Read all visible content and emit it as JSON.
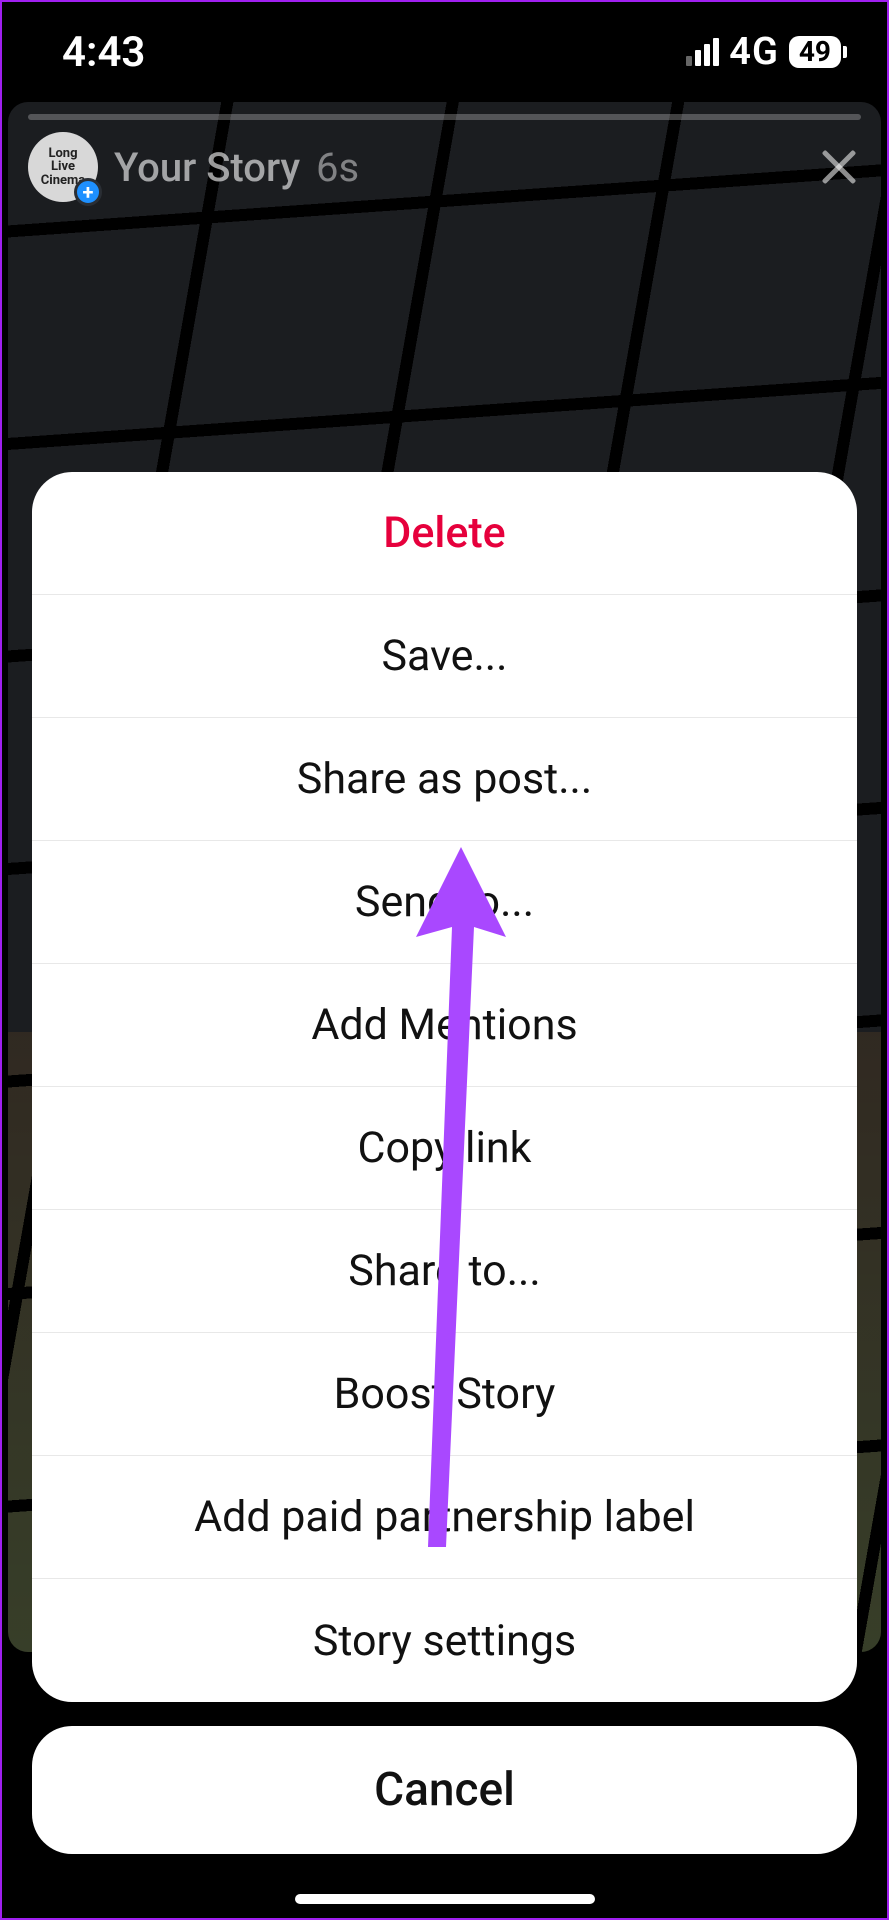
{
  "status": {
    "time": "4:43",
    "network": "4G",
    "battery": "49"
  },
  "story": {
    "avatar_text": "Long\nLive\nCinema",
    "title": "Your Story",
    "age": "6s"
  },
  "sheet": {
    "items": [
      "Delete",
      "Save...",
      "Share as post...",
      "Send to...",
      "Add Mentions",
      "Copy link",
      "Share to...",
      "Boost Story",
      "Add paid partnership label",
      "Story settings"
    ],
    "cancel": "Cancel"
  }
}
